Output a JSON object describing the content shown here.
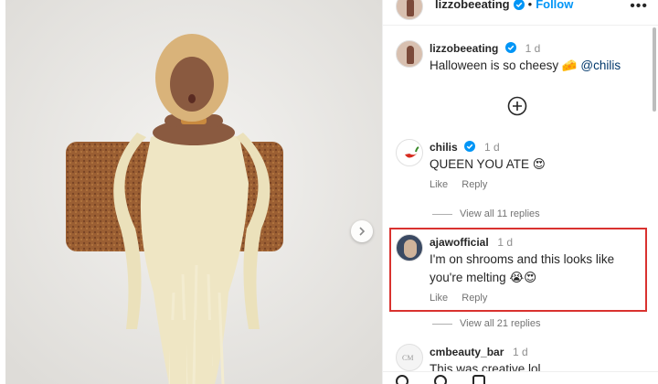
{
  "post": {
    "author": "lizzobeeating",
    "follow_label": "Follow",
    "separator": "•",
    "more_label": "•••",
    "caption": {
      "username": "lizzobeeating",
      "time": "1 d",
      "text": "Halloween is so cheesy",
      "emoji": "🧀",
      "mention": "@chilis"
    }
  },
  "comments": [
    {
      "username": "chilis",
      "verified": true,
      "time": "1 d",
      "text": "QUEEN YOU ATE 😍",
      "like_label": "Like",
      "reply_label": "Reply",
      "view_replies": "View all 11 replies"
    },
    {
      "username": "ajawofficial",
      "verified": false,
      "time": "1 d",
      "text_line1": "I'm on shrooms and this looks like",
      "text_line2": "you're melting 😭😍",
      "like_label": "Like",
      "reply_label": "Reply",
      "view_replies": "View all 21 replies"
    },
    {
      "username": "cmbeauty_bar",
      "time": "1 d",
      "text": "This was creative lol"
    }
  ],
  "colors": {
    "follow": "#0095f6",
    "verified": "#0095f6",
    "highlight_box": "#d9322f",
    "mention": "#00376b"
  }
}
